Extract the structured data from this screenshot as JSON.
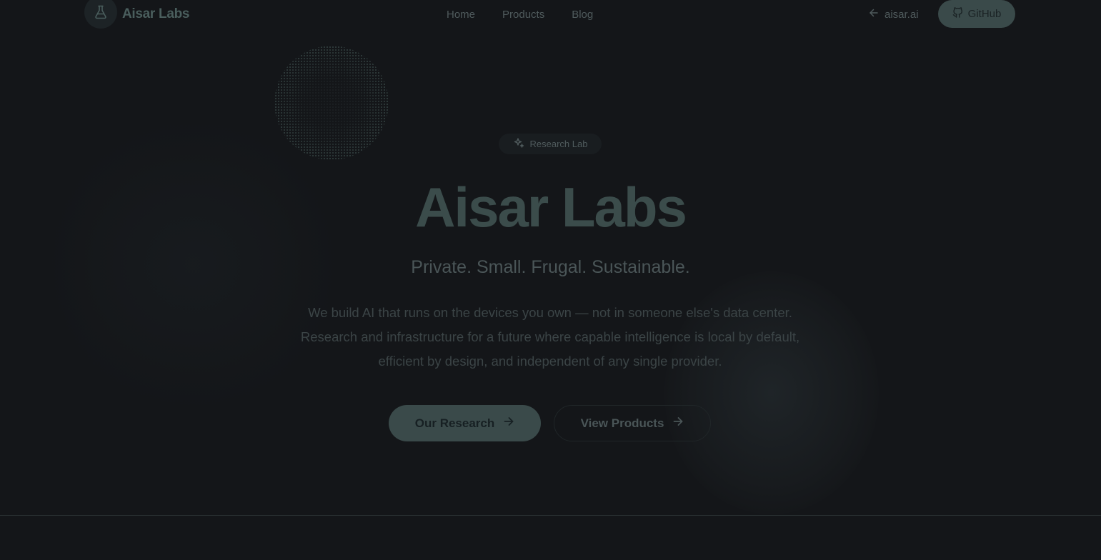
{
  "nav": {
    "brand": "Aisar Labs",
    "links": [
      "Home",
      "Products",
      "Blog"
    ],
    "back_link": "aisar.ai",
    "github_label": "GitHub"
  },
  "hero": {
    "badge": "Research Lab",
    "title": "Aisar Labs",
    "tagline": "Private. Small. Frugal. Sustainable.",
    "description_lines": [
      "We build AI that runs on the devices you own — not in someone else's data center.",
      "Research and infrastructure for a future where capable intelligence is local by default,",
      "efficient by design, and independent of any single provider."
    ],
    "primary_cta": "Our Research",
    "secondary_cta": "View Products"
  },
  "colors": {
    "background": "#141619",
    "accent": "#3a4a4a",
    "muted_text": "#4f5a5c"
  },
  "icons": {
    "logo": "flask-icon",
    "back": "arrow-left-icon",
    "github": "github-icon",
    "badge": "sparkles-icon",
    "cta": "arrow-right-icon"
  }
}
